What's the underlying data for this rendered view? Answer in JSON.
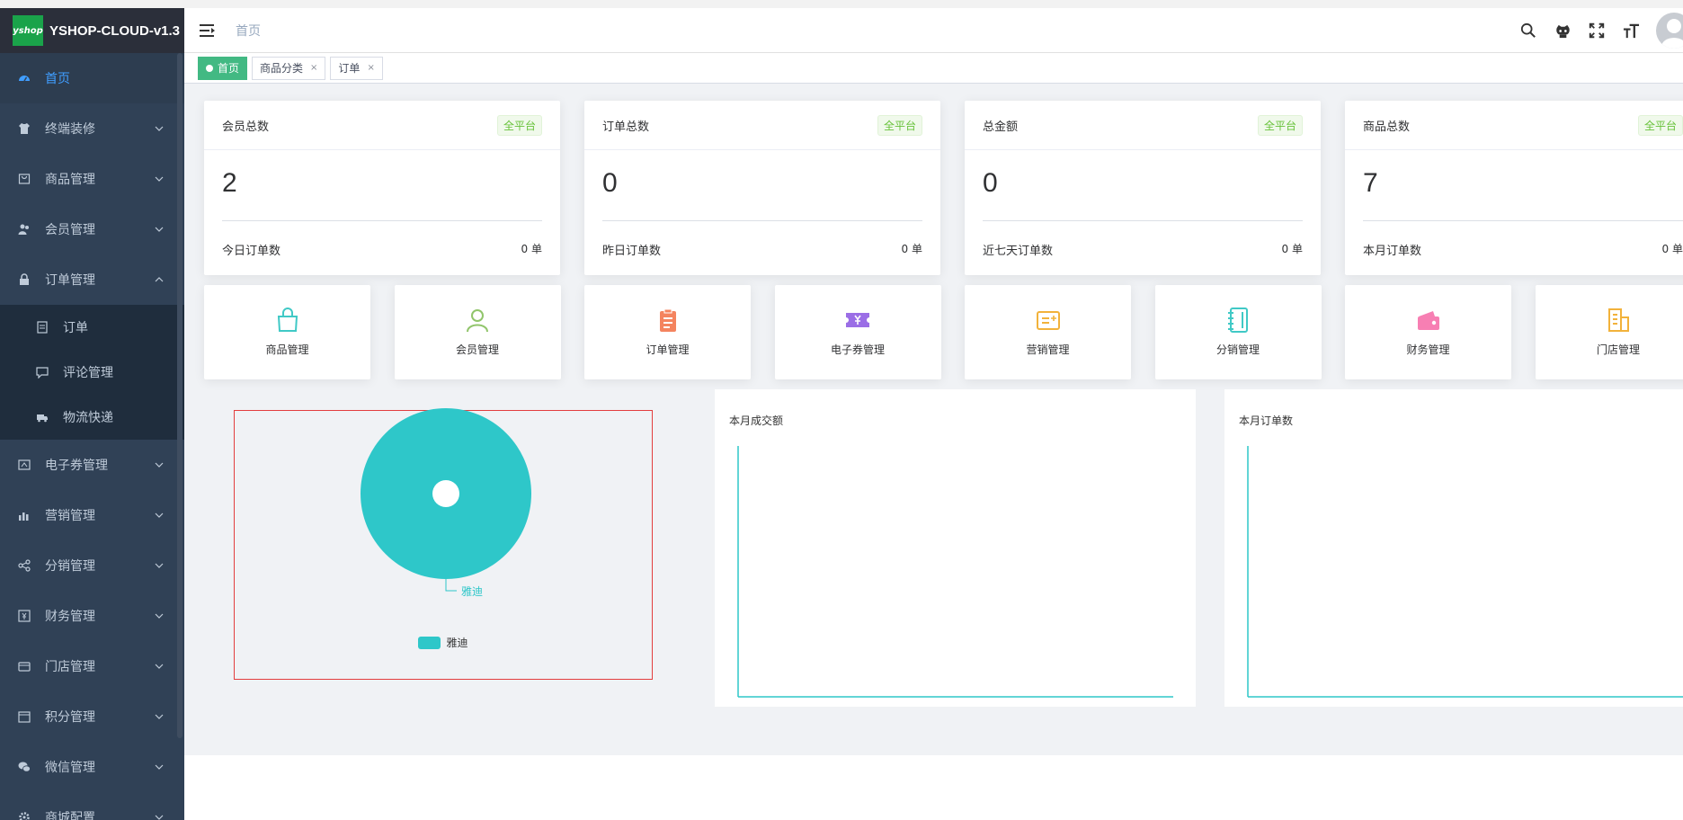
{
  "app": {
    "title": "YSHOP-CLOUD-v1.3",
    "logo_text": "yshop"
  },
  "sidebar": {
    "items": [
      {
        "label": "首页",
        "icon": "dashboard-icon",
        "active": true
      },
      {
        "label": "终端装修",
        "icon": "shirt-icon"
      },
      {
        "label": "商品管理",
        "icon": "bag-icon"
      },
      {
        "label": "会员管理",
        "icon": "peoples-icon"
      },
      {
        "label": "订单管理",
        "icon": "lock-icon",
        "open": true
      },
      {
        "label": "电子券管理",
        "icon": "coupon-icon"
      },
      {
        "label": "营销管理",
        "icon": "chart-icon"
      },
      {
        "label": "分销管理",
        "icon": "share-icon"
      },
      {
        "label": "财务管理",
        "icon": "money-icon"
      },
      {
        "label": "门店管理",
        "icon": "store-icon"
      },
      {
        "label": "积分管理",
        "icon": "calendar-icon"
      },
      {
        "label": "微信管理",
        "icon": "wechat-icon"
      },
      {
        "label": "商城配置",
        "icon": "gear-icon"
      }
    ],
    "submenu": [
      {
        "label": "订单",
        "icon": "order-doc-icon"
      },
      {
        "label": "评论管理",
        "icon": "comment-icon"
      },
      {
        "label": "物流快递",
        "icon": "truck-icon"
      }
    ]
  },
  "navbar": {
    "breadcrumb": "首页"
  },
  "tags": [
    {
      "label": "首页",
      "active": true
    },
    {
      "label": "商品分类"
    },
    {
      "label": "订单"
    }
  ],
  "stats": [
    {
      "title": "会员总数",
      "badge": "全平台",
      "value": "2",
      "foot_label": "今日订单数",
      "foot_value": "0 单"
    },
    {
      "title": "订单总数",
      "badge": "全平台",
      "value": "0",
      "foot_label": "昨日订单数",
      "foot_value": "0 单"
    },
    {
      "title": "总金额",
      "badge": "全平台",
      "value": "0",
      "foot_label": "近七天订单数",
      "foot_value": "0 单"
    },
    {
      "title": "商品总数",
      "badge": "全平台",
      "value": "7",
      "foot_label": "本月订单数",
      "foot_value": "0 单"
    }
  ],
  "shortcuts": [
    {
      "label": "商品管理",
      "icon": "shopping-bag-icon",
      "color": "#40c9c6"
    },
    {
      "label": "会员管理",
      "icon": "user-icon",
      "color": "#91c56b"
    },
    {
      "label": "订单管理",
      "icon": "clipboard-icon",
      "color": "#f4845f"
    },
    {
      "label": "电子券管理",
      "icon": "ticket-icon",
      "color": "#9b6ee6"
    },
    {
      "label": "营销管理",
      "icon": "promo-card-icon",
      "color": "#f2b23b"
    },
    {
      "label": "分销管理",
      "icon": "notebook-icon",
      "color": "#40c9c6"
    },
    {
      "label": "财务管理",
      "icon": "wallet-icon",
      "color": "#f77fb3"
    },
    {
      "label": "门店管理",
      "icon": "building-icon",
      "color": "#f2b23b"
    }
  ],
  "charts": {
    "line1_title": "本月成交额",
    "line2_title": "本月订单数"
  },
  "chart_data": [
    {
      "type": "pie",
      "categories": [
        "雅迪"
      ],
      "values": [
        1
      ],
      "legend": [
        "雅迪"
      ],
      "colors": [
        "#2ec7c9"
      ],
      "legend_position": "bottom"
    },
    {
      "type": "line",
      "title": "本月成交额",
      "x": [],
      "series": []
    },
    {
      "type": "line",
      "title": "本月订单数",
      "x": [],
      "series": []
    }
  ]
}
